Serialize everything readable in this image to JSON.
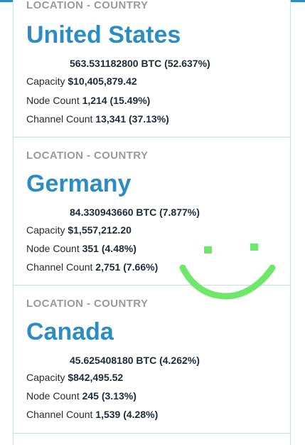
{
  "colors": {
    "accent": "#2c8cc4",
    "label_gray": "#9a9a9a",
    "doodle_green": "#6fe86a"
  },
  "cards": [
    {
      "location_label": "LOCATION - COUNTRY",
      "country": "United States",
      "btc": "563.531182800 BTC (52.637%)",
      "capacity_label": "Capacity",
      "capacity_value": "$10,405,879.42",
      "node_label": "Node Count",
      "node_value": "1,214 (15.49%)",
      "channel_label": "Channel Count",
      "channel_value": "13,341 (37.13%)"
    },
    {
      "location_label": "LOCATION - COUNTRY",
      "country": "Germany",
      "btc": "84.330943660 BTC (7.877%)",
      "capacity_label": "Capacity",
      "capacity_value": "$1,557,212.20",
      "node_label": "Node Count",
      "node_value": "351 (4.48%)",
      "channel_label": "Channel Count",
      "channel_value": "2,751 (7.66%)"
    },
    {
      "location_label": "LOCATION - COUNTRY",
      "country": "Canada",
      "btc": "45.625408180 BTC (4.262%)",
      "capacity_label": "Capacity",
      "capacity_value": "$842,495.52",
      "node_label": "Node Count",
      "node_value": "245 (3.13%)",
      "channel_label": "Channel Count",
      "channel_value": "1,539 (4.28%)"
    }
  ],
  "overlay": {
    "doodle": "smiley-doodle-icon"
  }
}
